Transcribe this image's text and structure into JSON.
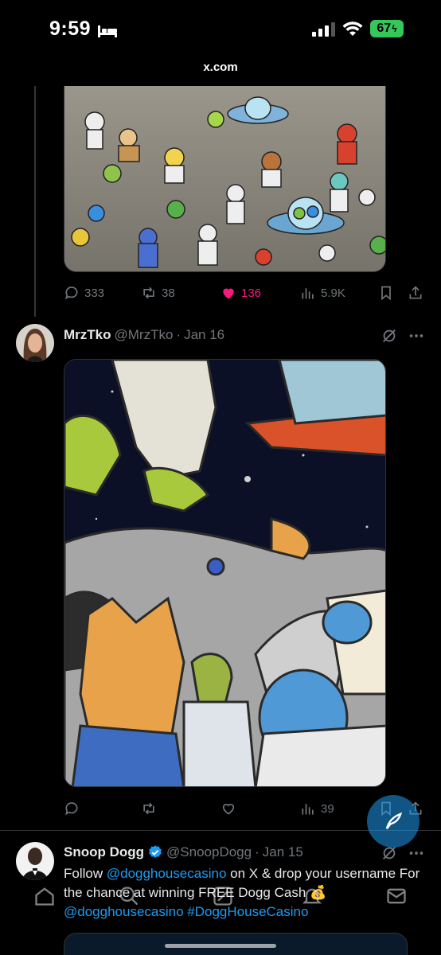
{
  "status_bar": {
    "time": "9:59",
    "battery": "67",
    "url": "x.com"
  },
  "tweet1": {
    "image_alt": "Cartoon crowd of aliens, astronauts and flying saucers on the moon",
    "actions": {
      "replies": "333",
      "reposts": "38",
      "likes": "136",
      "views": "5.9K"
    }
  },
  "tweet2": {
    "name": "MrzTko",
    "handle": "@MrzTko",
    "sep": "·",
    "date": "Jan 16",
    "image_alt": "Zoomed cartoon astronauts and aliens under a flying saucer",
    "actions": {
      "views": "39"
    }
  },
  "tweet3": {
    "name": "Snoop Dogg",
    "handle": "@SnoopDogg",
    "sep": "·",
    "date": "Jan 15",
    "text": {
      "p1": "Follow ",
      "m1": "@dogghousecasino",
      "p2": " on X & drop your username For the chance at winning FREE Dogg Cash 💰 ",
      "m2": "@dogghousecasino",
      "p3": " ",
      "h1": "#DoggHouseCasino"
    }
  },
  "colors": {
    "accent": "#1d9bf0",
    "like": "#f91880",
    "muted": "#71767b",
    "battery": "#34c759"
  },
  "icons": [
    "reply-icon",
    "repost-icon",
    "like-icon",
    "views-icon",
    "bookmark-icon",
    "share-icon",
    "grok-icon",
    "more-icon",
    "verified-icon",
    "compose-icon",
    "home-icon",
    "search-icon",
    "grok-nav-icon",
    "notifications-icon",
    "messages-icon"
  ]
}
